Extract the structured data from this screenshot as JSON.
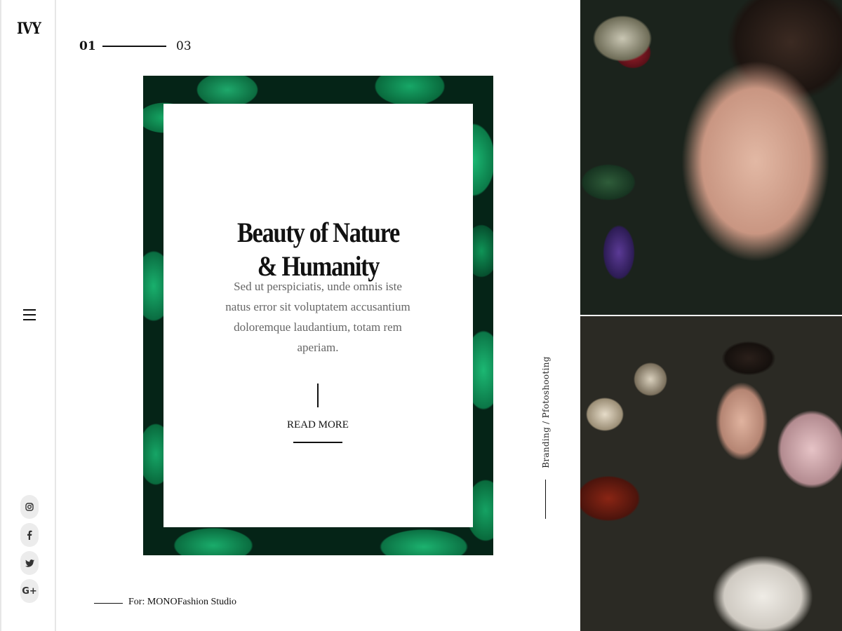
{
  "sidebar": {
    "logo": "IVY",
    "menu_icon": "hamburger-icon",
    "socials": [
      {
        "icon": "instagram-icon",
        "glyph": "◎"
      },
      {
        "icon": "facebook-icon",
        "glyph": "f"
      },
      {
        "icon": "twitter-icon",
        "glyph": "🐦"
      },
      {
        "icon": "google-plus-icon",
        "glyph": "G+"
      }
    ]
  },
  "slider": {
    "current": "01",
    "total": "03"
  },
  "card": {
    "title_line1": "Beauty of Nature",
    "title_line2": "& Humanity",
    "text": "Sed ut perspiciatis, unde omnis iste natus error sit voluptatem accusantium doloremque laudantium, totam rem aperiam.",
    "cta": "READ MORE"
  },
  "client": "For: MONOFashion Studio",
  "category": "Branding / Pfotoshooting"
}
